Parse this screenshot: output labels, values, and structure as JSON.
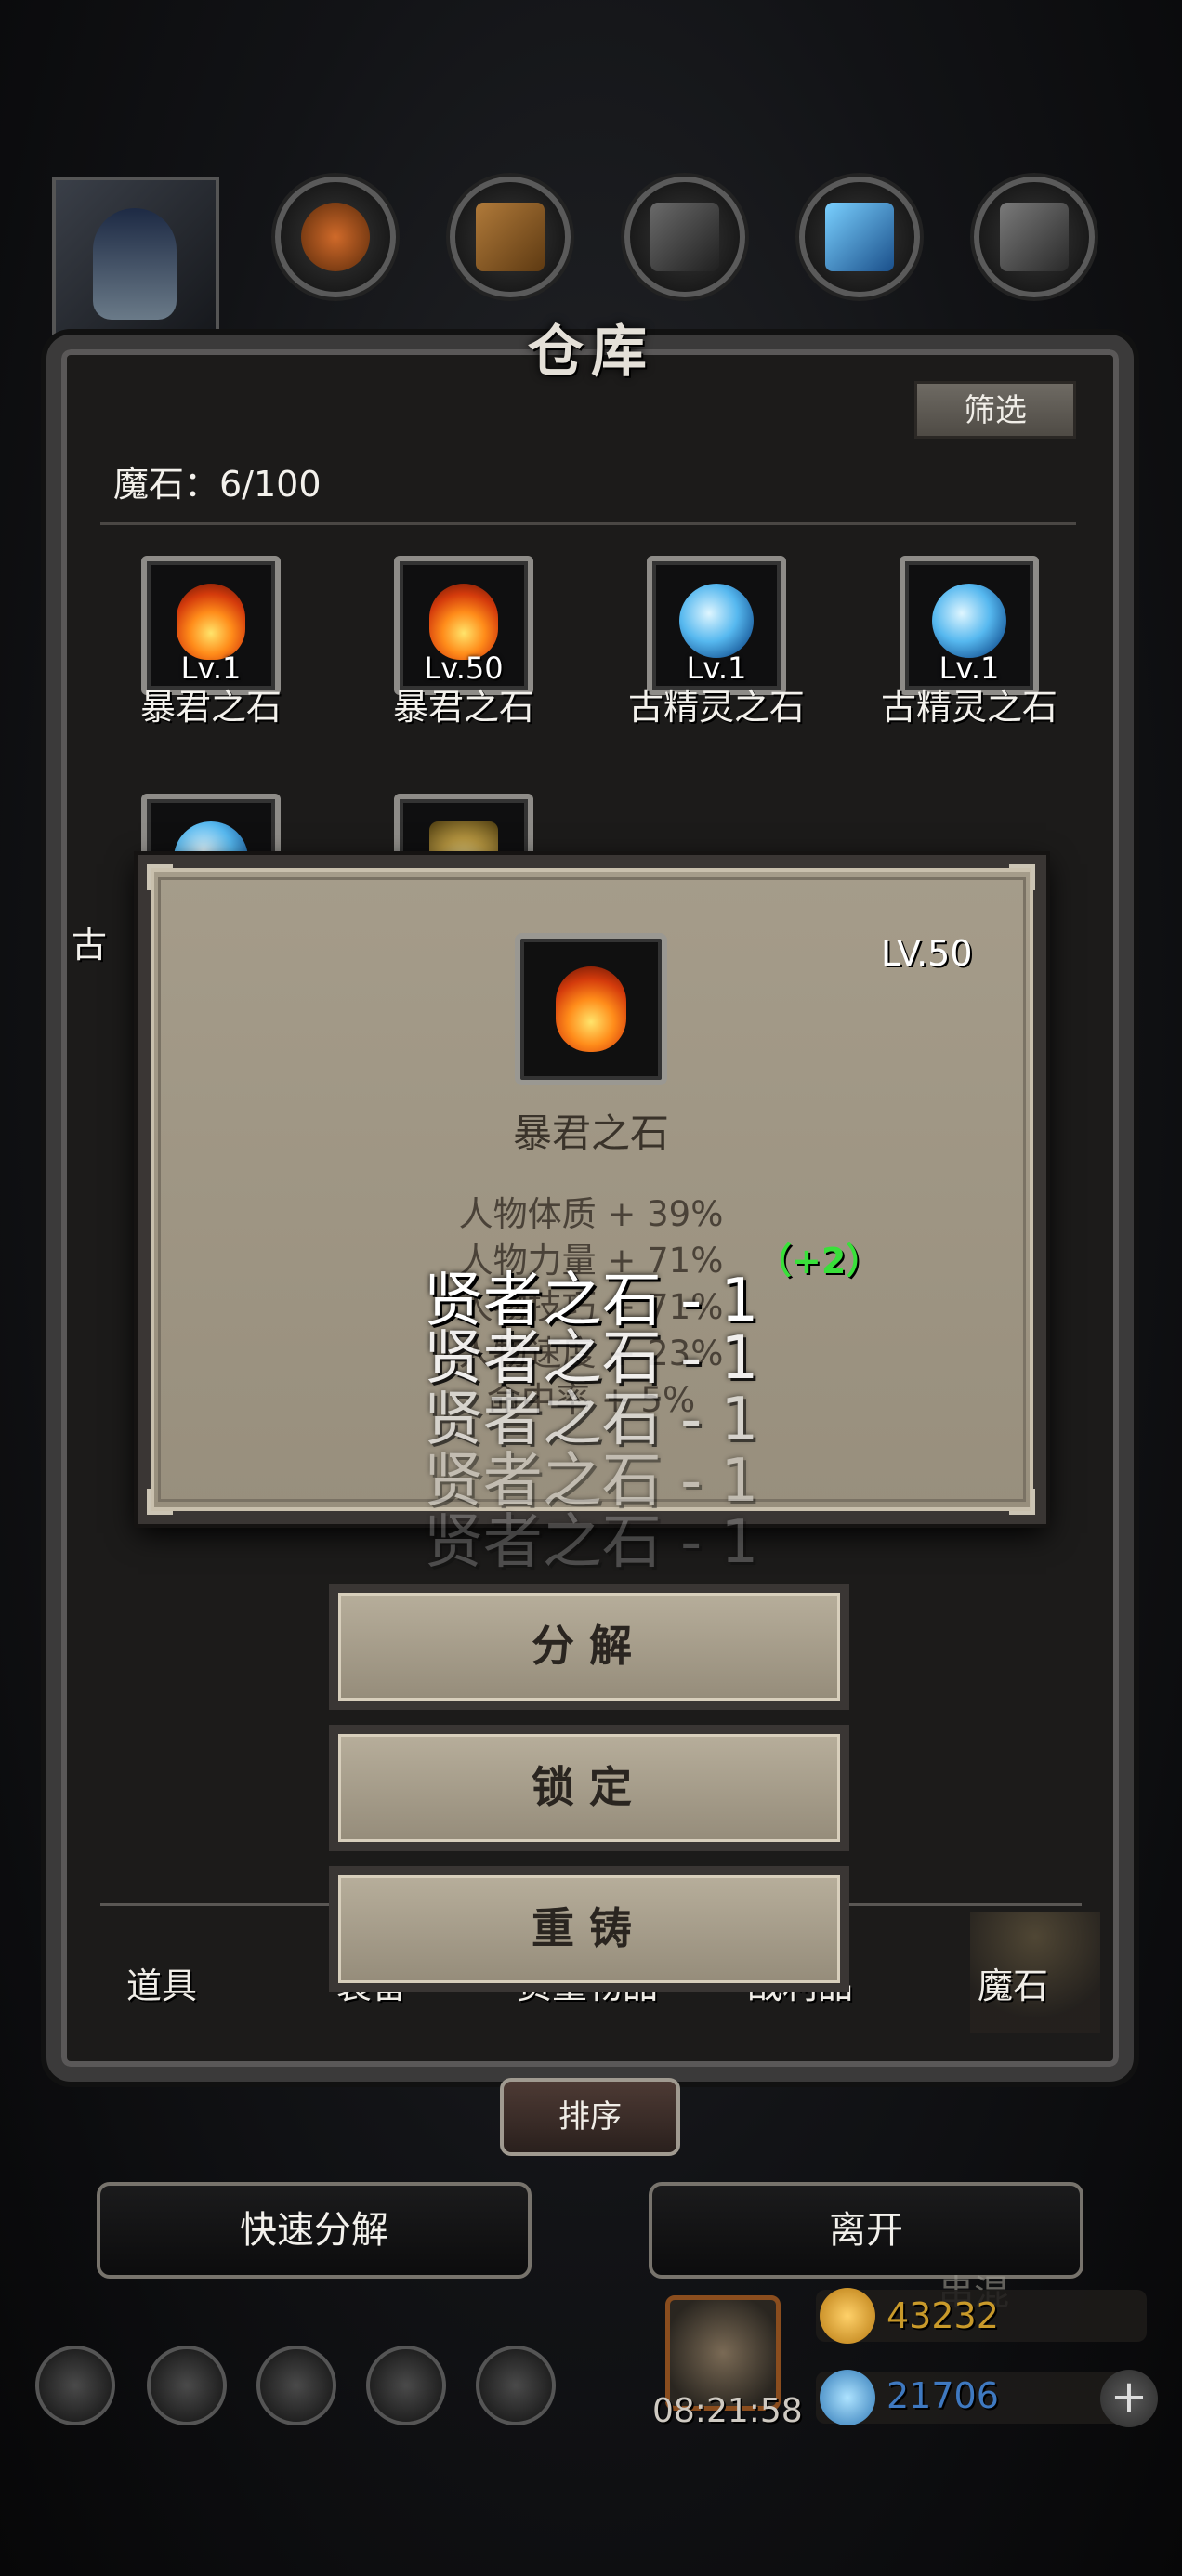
{
  "header": {
    "title": "仓库",
    "filter_label": "筛选"
  },
  "inventory": {
    "count_label": "魔石：6/100",
    "items": [
      {
        "name": "暴君之石",
        "level": "Lv.1",
        "gem": "fire"
      },
      {
        "name": "暴君之石",
        "level": "Lv.50",
        "gem": "fire"
      },
      {
        "name": "古精灵之石",
        "level": "Lv.1",
        "gem": "ice"
      },
      {
        "name": "古精灵之石",
        "level": "Lv.1",
        "gem": "ice"
      },
      {
        "name": "古",
        "level": "",
        "gem": "ice"
      },
      {
        "name": "",
        "level": "",
        "gem": "gold"
      }
    ]
  },
  "tabs": {
    "items": [
      "道具",
      "装备",
      "资董物品",
      "战利品",
      "魔石"
    ],
    "active": "魔石"
  },
  "sort_label": "排序",
  "buttons": {
    "quick_decompose": "快速分解",
    "leave": "离开"
  },
  "currency": {
    "gold": "43232",
    "diamond": "21706",
    "partial_label": "串混"
  },
  "gift": {
    "timer": "08:21:58"
  },
  "detail": {
    "level": "LV.50",
    "name": "暴君之石",
    "stats": [
      "人物体质 + 39%",
      "人物力量 + 71%",
      "人物技巧 + 71%",
      "人物速度 + 23%",
      "命中率 + 5%"
    ],
    "bonus": "（+2）",
    "floating": [
      "贤者之石 - 1",
      "贤者之石 - 1",
      "贤者之石 - 1",
      "贤者之石 - 1",
      "贤者之石 - 1"
    ],
    "actions": [
      "分解",
      "锁定",
      "重铸"
    ]
  },
  "colors": {
    "bonus": "#39e03a",
    "modal_bg": "#a59c8a",
    "panel_border": "#3b3a3a"
  }
}
